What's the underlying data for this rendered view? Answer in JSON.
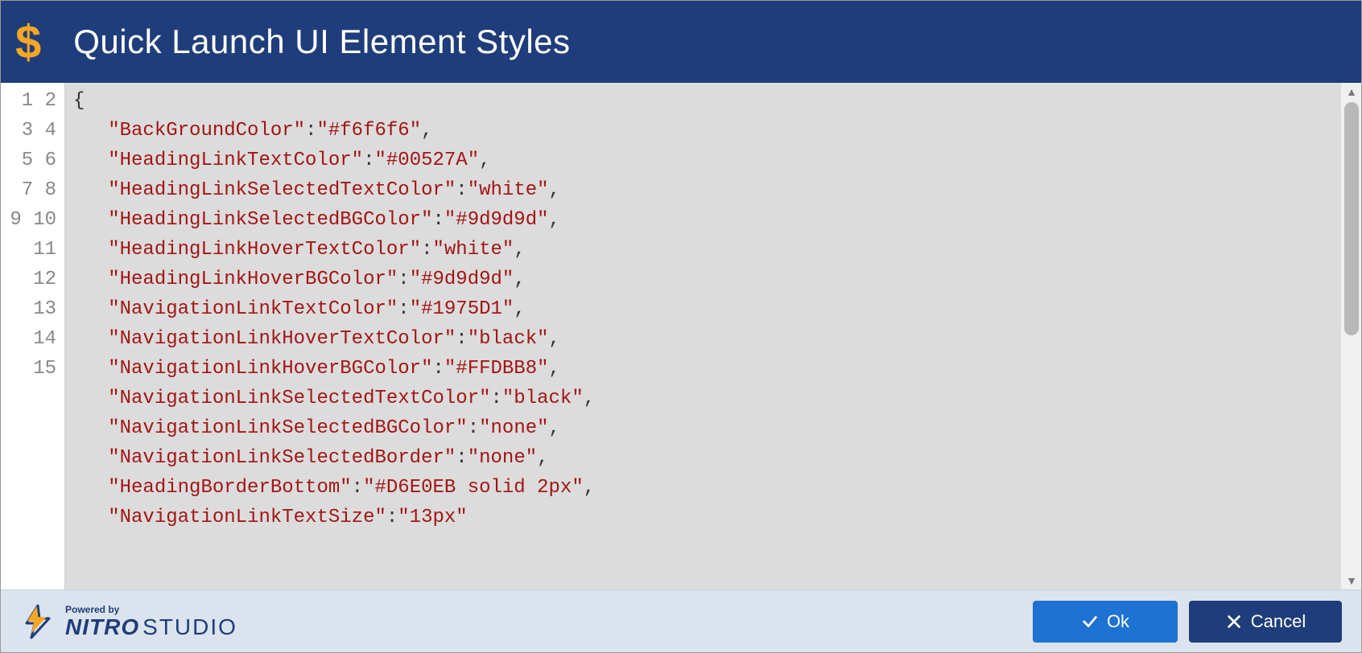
{
  "header": {
    "icon_glyph": "$",
    "title": "Quick Launch UI Element Styles"
  },
  "editor": {
    "total_visible_lines": 15,
    "lines": [
      {
        "n": 1,
        "brace": "{"
      },
      {
        "n": 2,
        "key": "BackGroundColor",
        "value": "#f6f6f6",
        "comma": true
      },
      {
        "n": 3,
        "key": "HeadingLinkTextColor",
        "value": "#00527A",
        "comma": true
      },
      {
        "n": 4,
        "key": "HeadingLinkSelectedTextColor",
        "value": "white",
        "comma": true
      },
      {
        "n": 5,
        "key": "HeadingLinkSelectedBGColor",
        "value": "#9d9d9d",
        "comma": true
      },
      {
        "n": 6,
        "key": "HeadingLinkHoverTextColor",
        "value": "white",
        "comma": true
      },
      {
        "n": 7,
        "key": "HeadingLinkHoverBGColor",
        "value": "#9d9d9d",
        "comma": true
      },
      {
        "n": 8,
        "key": "NavigationLinkTextColor",
        "value": "#1975D1",
        "comma": true
      },
      {
        "n": 9,
        "key": "NavigationLinkHoverTextColor",
        "value": "black",
        "comma": true
      },
      {
        "n": 10,
        "key": "NavigationLinkHoverBGColor",
        "value": "#FFDBB8",
        "comma": true
      },
      {
        "n": 11,
        "key": "NavigationLinkSelectedTextColor",
        "value": "black",
        "comma": true
      },
      {
        "n": 12,
        "key": "NavigationLinkSelectedBGColor",
        "value": "none",
        "comma": true
      },
      {
        "n": 13,
        "key": "NavigationLinkSelectedBorder",
        "value": "none",
        "comma": true
      },
      {
        "n": 14,
        "key": "HeadingBorderBottom",
        "value": "#D6E0EB solid 2px",
        "comma": true
      },
      {
        "n": 15,
        "key": "NavigationLinkTextSize",
        "value": "13px",
        "comma": false
      }
    ]
  },
  "footer": {
    "powered_by": "Powered by",
    "brand_bold": "NITRO",
    "brand_light": "STUDIO",
    "ok_label": "Ok",
    "cancel_label": "Cancel"
  }
}
